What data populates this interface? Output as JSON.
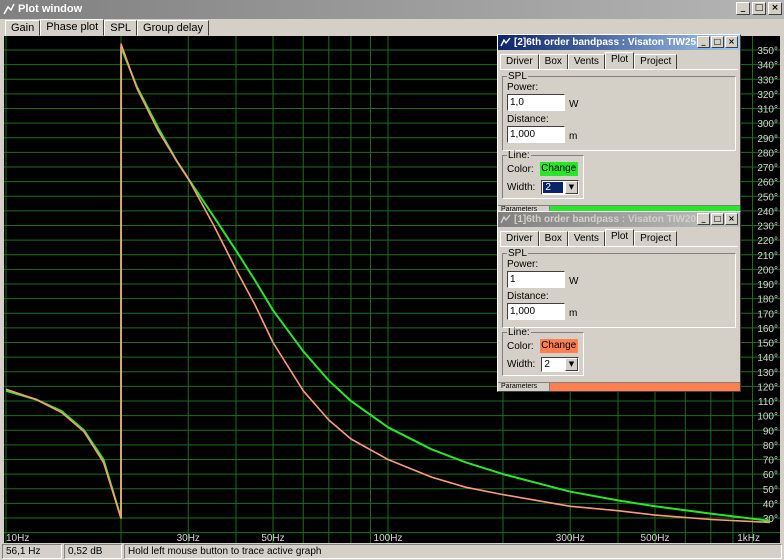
{
  "window": {
    "title": "Plot window",
    "buttons": [
      "_",
      "□",
      "×"
    ]
  },
  "tabs": [
    {
      "label": "Gain",
      "active": false
    },
    {
      "label": "Phase plot",
      "active": true
    },
    {
      "label": "SPL",
      "active": false
    },
    {
      "label": "Group delay",
      "active": false
    }
  ],
  "colors": {
    "background": "#000000",
    "grid": "#1e6e1e",
    "trace_green": "#28e628",
    "trace_orange": "#ff9a7a",
    "label": "#d6d6d6"
  },
  "plot": {
    "x_labels": [
      "10Hz",
      "30Hz",
      "50Hz",
      "100Hz",
      "300Hz",
      "500Hz",
      "1kHz"
    ],
    "y_labels": [
      "350°",
      "340°",
      "330°",
      "320°",
      "310°",
      "300°",
      "290°",
      "280°",
      "270°",
      "260°",
      "250°",
      "240°",
      "230°",
      "220°",
      "210°",
      "200°",
      "190°",
      "180°",
      "170°",
      "160°",
      "150°",
      "140°",
      "130°",
      "120°",
      "110°",
      "100°",
      "90°",
      "80°",
      "70°",
      "60°",
      "50°",
      "40°",
      "30°"
    ]
  },
  "chart_data": {
    "type": "line",
    "x_scale": "log",
    "xlim": [
      10,
      1000
    ],
    "ylim": [
      23,
      360
    ],
    "xlabel": "",
    "ylabel": "",
    "grid": true,
    "series": [
      {
        "name": "[2]6th order bandpass",
        "color": "#28e628",
        "x": [
          10,
          12,
          14,
          16,
          18,
          20,
          20.01,
          22,
          25,
          28,
          30,
          35,
          40,
          45,
          50,
          60,
          70,
          80,
          100,
          130,
          160,
          200,
          300,
          400,
          500,
          700,
          1000
        ],
        "y": [
          117,
          111,
          103,
          90,
          70,
          30,
          352,
          325,
          297,
          274,
          262,
          236,
          213,
          192,
          172,
          144,
          124,
          110,
          92,
          77,
          68,
          60,
          48,
          42,
          38,
          33,
          28
        ]
      },
      {
        "name": "[1]6th order bandpass",
        "color": "#ff9a7a",
        "x": [
          10,
          12,
          14,
          16,
          18,
          20,
          20.01,
          22,
          25,
          28,
          30,
          35,
          40,
          45,
          50,
          60,
          70,
          80,
          100,
          130,
          160,
          200,
          300,
          400,
          500,
          700,
          1000
        ],
        "y": [
          118,
          111,
          102,
          89,
          68,
          30,
          354,
          324,
          295,
          274,
          262,
          230,
          200,
          175,
          150,
          117,
          97,
          84,
          70,
          58,
          51,
          46,
          38,
          35,
          32,
          29,
          27
        ]
      }
    ]
  },
  "child_windows": [
    {
      "title": "[2]6th order bandpass : Visaton TIW25...",
      "tabs": [
        "Driver",
        "Box",
        "Vents",
        "Plot",
        "Project"
      ],
      "active_tab": "Plot",
      "spl_label": "SPL",
      "power_label": "Power:",
      "power_value": "1,0",
      "power_unit": "W",
      "distance_label": "Distance:",
      "distance_value": "1,000",
      "distance_unit": "m",
      "line_label": "Line:",
      "color_label": "Color:",
      "change_label": "Change",
      "change_color": "#28e628",
      "width_label": "Width:",
      "width_value": "2",
      "parameters_label": "Parameters",
      "bar_color": "#28e628"
    },
    {
      "title": "[1]6th order bandpass : Visaton TIW20...",
      "tabs": [
        "Driver",
        "Box",
        "Vents",
        "Plot",
        "Project"
      ],
      "active_tab": "Plot",
      "spl_label": "SPL",
      "power_label": "Power:",
      "power_value": "1",
      "power_unit": "W",
      "distance_label": "Distance:",
      "distance_value": "1,000",
      "distance_unit": "m",
      "line_label": "Line:",
      "color_label": "Color:",
      "change_label": "Change",
      "change_color": "#ff7f50",
      "width_label": "Width:",
      "width_value": "2",
      "parameters_label": "Parameters",
      "bar_color": "#ff7f50"
    }
  ],
  "status": {
    "freq": "56,1 Hz",
    "value": "0,52 dB",
    "hint": "Hold left mouse button to trace active graph"
  }
}
